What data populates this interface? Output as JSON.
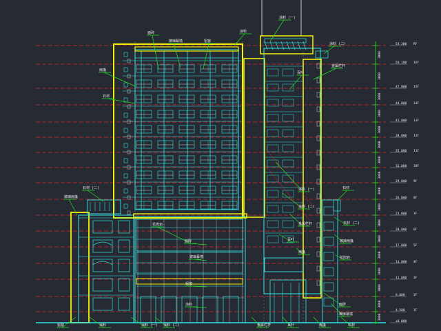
{
  "drawing": {
    "title": "Building elevation drawing (CAD)",
    "colors": {
      "background": "#262a33",
      "outline": "#f2f20a",
      "structure": "#2ee6e6",
      "leader": "#22e022",
      "levelLine": "#e0242c",
      "text": "#e8e8e8"
    },
    "level_labels": [
      "53.300",
      "50.100",
      "47.000",
      "44.000",
      "41.000",
      "38.000",
      "35.000",
      "32.000",
      "29.000",
      "26.000",
      "23.000",
      "20.000",
      "17.000",
      "14.000",
      "11.000",
      "8.000",
      "4.500",
      "±0.000"
    ],
    "floor_labels": [
      "RF",
      "16F",
      "15F",
      "14F",
      "13F",
      "12F",
      "11F",
      "10F",
      "9F",
      "8F",
      "7F",
      "6F",
      "5F",
      "4F",
      "3F",
      "2F",
      "1F"
    ],
    "callouts": [
      "面砖",
      "玻璃幕墙",
      "铝窗",
      "涂料",
      "涂料 (一)",
      "涂料 (二)",
      "金属栏杆",
      "百叶",
      "雨篷",
      "石材",
      "石材 (二)",
      "玻璃雨篷",
      "花岗岩"
    ]
  }
}
